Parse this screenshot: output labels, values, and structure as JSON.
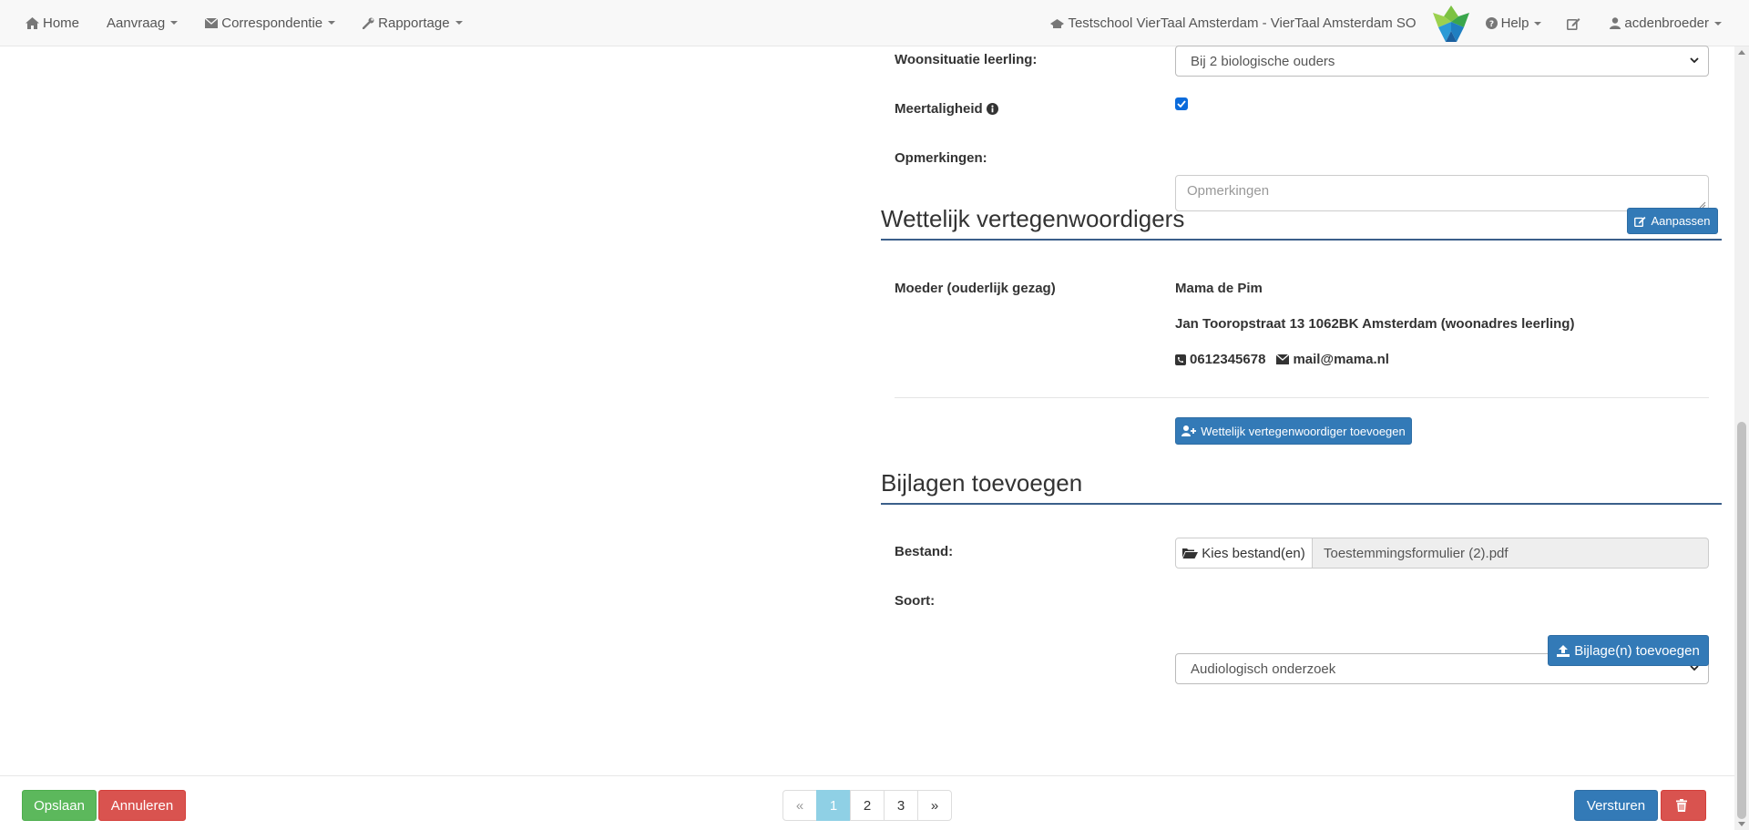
{
  "navbar": {
    "home": "Home",
    "aanvraag": "Aanvraag",
    "correspondentie": "Correspondentie",
    "rapportage": "Rapportage",
    "school": "Testschool VierTaal Amsterdam - VierTaal Amsterdam SO",
    "help": "Help",
    "user": "acdenbroeder"
  },
  "form": {
    "woonsituatie_label": "Woonsituatie leerling:",
    "woonsituatie_value": "Bij 2 biologische ouders",
    "meertaligheid_label": "Meertaligheid",
    "meertaligheid_checked": true,
    "opmerkingen_label": "Opmerkingen:",
    "opmerkingen_placeholder": "Opmerkingen"
  },
  "vertegenwoordigers": {
    "title": "Wettelijk vertegenwoordigers",
    "aanpassen": "Aanpassen",
    "relation": "Moeder (ouderlijk gezag)",
    "name": "Mama de Pim",
    "address": "Jan Tooropstraat 13 1062BK Amsterdam (woonadres leerling)",
    "phone": "0612345678",
    "email": "mail@mama.nl",
    "add_button": "Wettelijk vertegenwoordiger toevoegen"
  },
  "bijlagen": {
    "title": "Bijlagen toevoegen",
    "bestand_label": "Bestand:",
    "choose_button": "Kies bestand(en)",
    "file_name": "Toestemmingsformulier (2).pdf",
    "soort_label": "Soort:",
    "soort_value": "Audiologisch onderzoek",
    "upload_button": "Bijlage(n) toevoegen"
  },
  "footer": {
    "save": "Opslaan",
    "cancel": "Annuleren",
    "send": "Versturen",
    "pager": {
      "prev": "«",
      "pages": [
        "1",
        "2",
        "3"
      ],
      "active": "1",
      "next": "»"
    }
  },
  "colors": {
    "primary": "#337ab7",
    "success": "#5cb85c",
    "danger": "#d9534f",
    "pager_active": "#8fd0e5",
    "section_rule": "#3b5f8a"
  }
}
